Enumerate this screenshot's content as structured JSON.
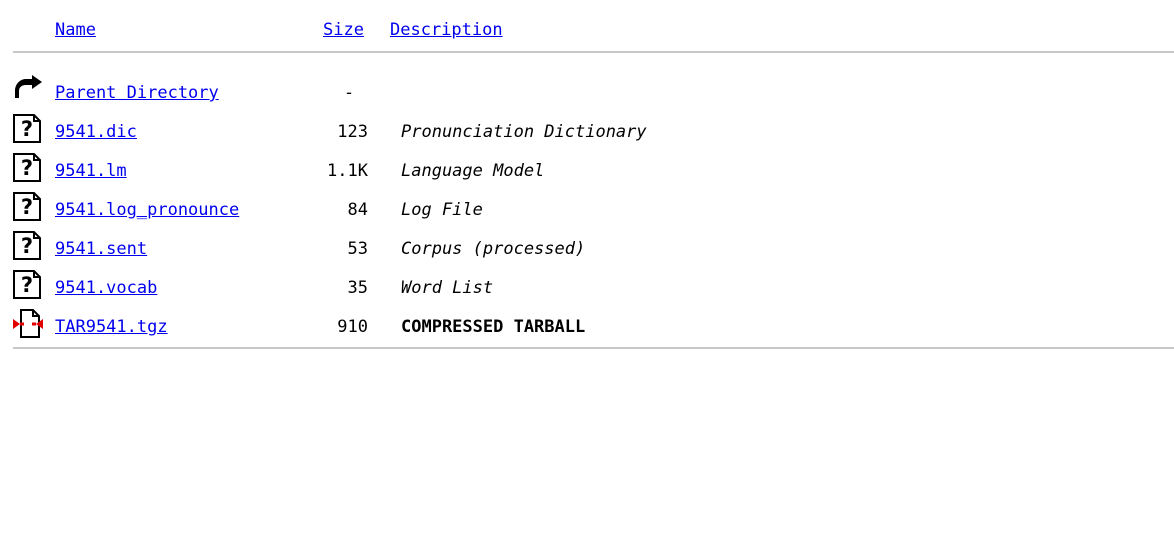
{
  "header": {
    "name_label": "Name",
    "size_label": "Size",
    "description_label": "Description"
  },
  "parent": {
    "label": "Parent Directory",
    "size": "-",
    "icon": "back-arrow-icon"
  },
  "entries": [
    {
      "name": "9541.dic",
      "size": "123",
      "description": "Pronunciation Dictionary",
      "icon": "unknown-file-icon"
    },
    {
      "name": "9541.lm",
      "size": "1.1K",
      "description": "Language Model",
      "icon": "unknown-file-icon"
    },
    {
      "name": "9541.log_pronounce",
      "size": "84",
      "description": "Log File",
      "icon": "unknown-file-icon"
    },
    {
      "name": "9541.sent",
      "size": "53",
      "description": "Corpus (processed)",
      "icon": "unknown-file-icon"
    },
    {
      "name": "9541.vocab",
      "size": "35",
      "description": "Word List",
      "icon": "unknown-file-icon"
    },
    {
      "name": "TAR9541.tgz",
      "size": "910",
      "description": "COMPRESSED TARBALL",
      "icon": "compressed-file-icon"
    }
  ],
  "colors": {
    "link": "#0000ee",
    "rule": "#c8c8c8",
    "background": "#ffffff"
  }
}
